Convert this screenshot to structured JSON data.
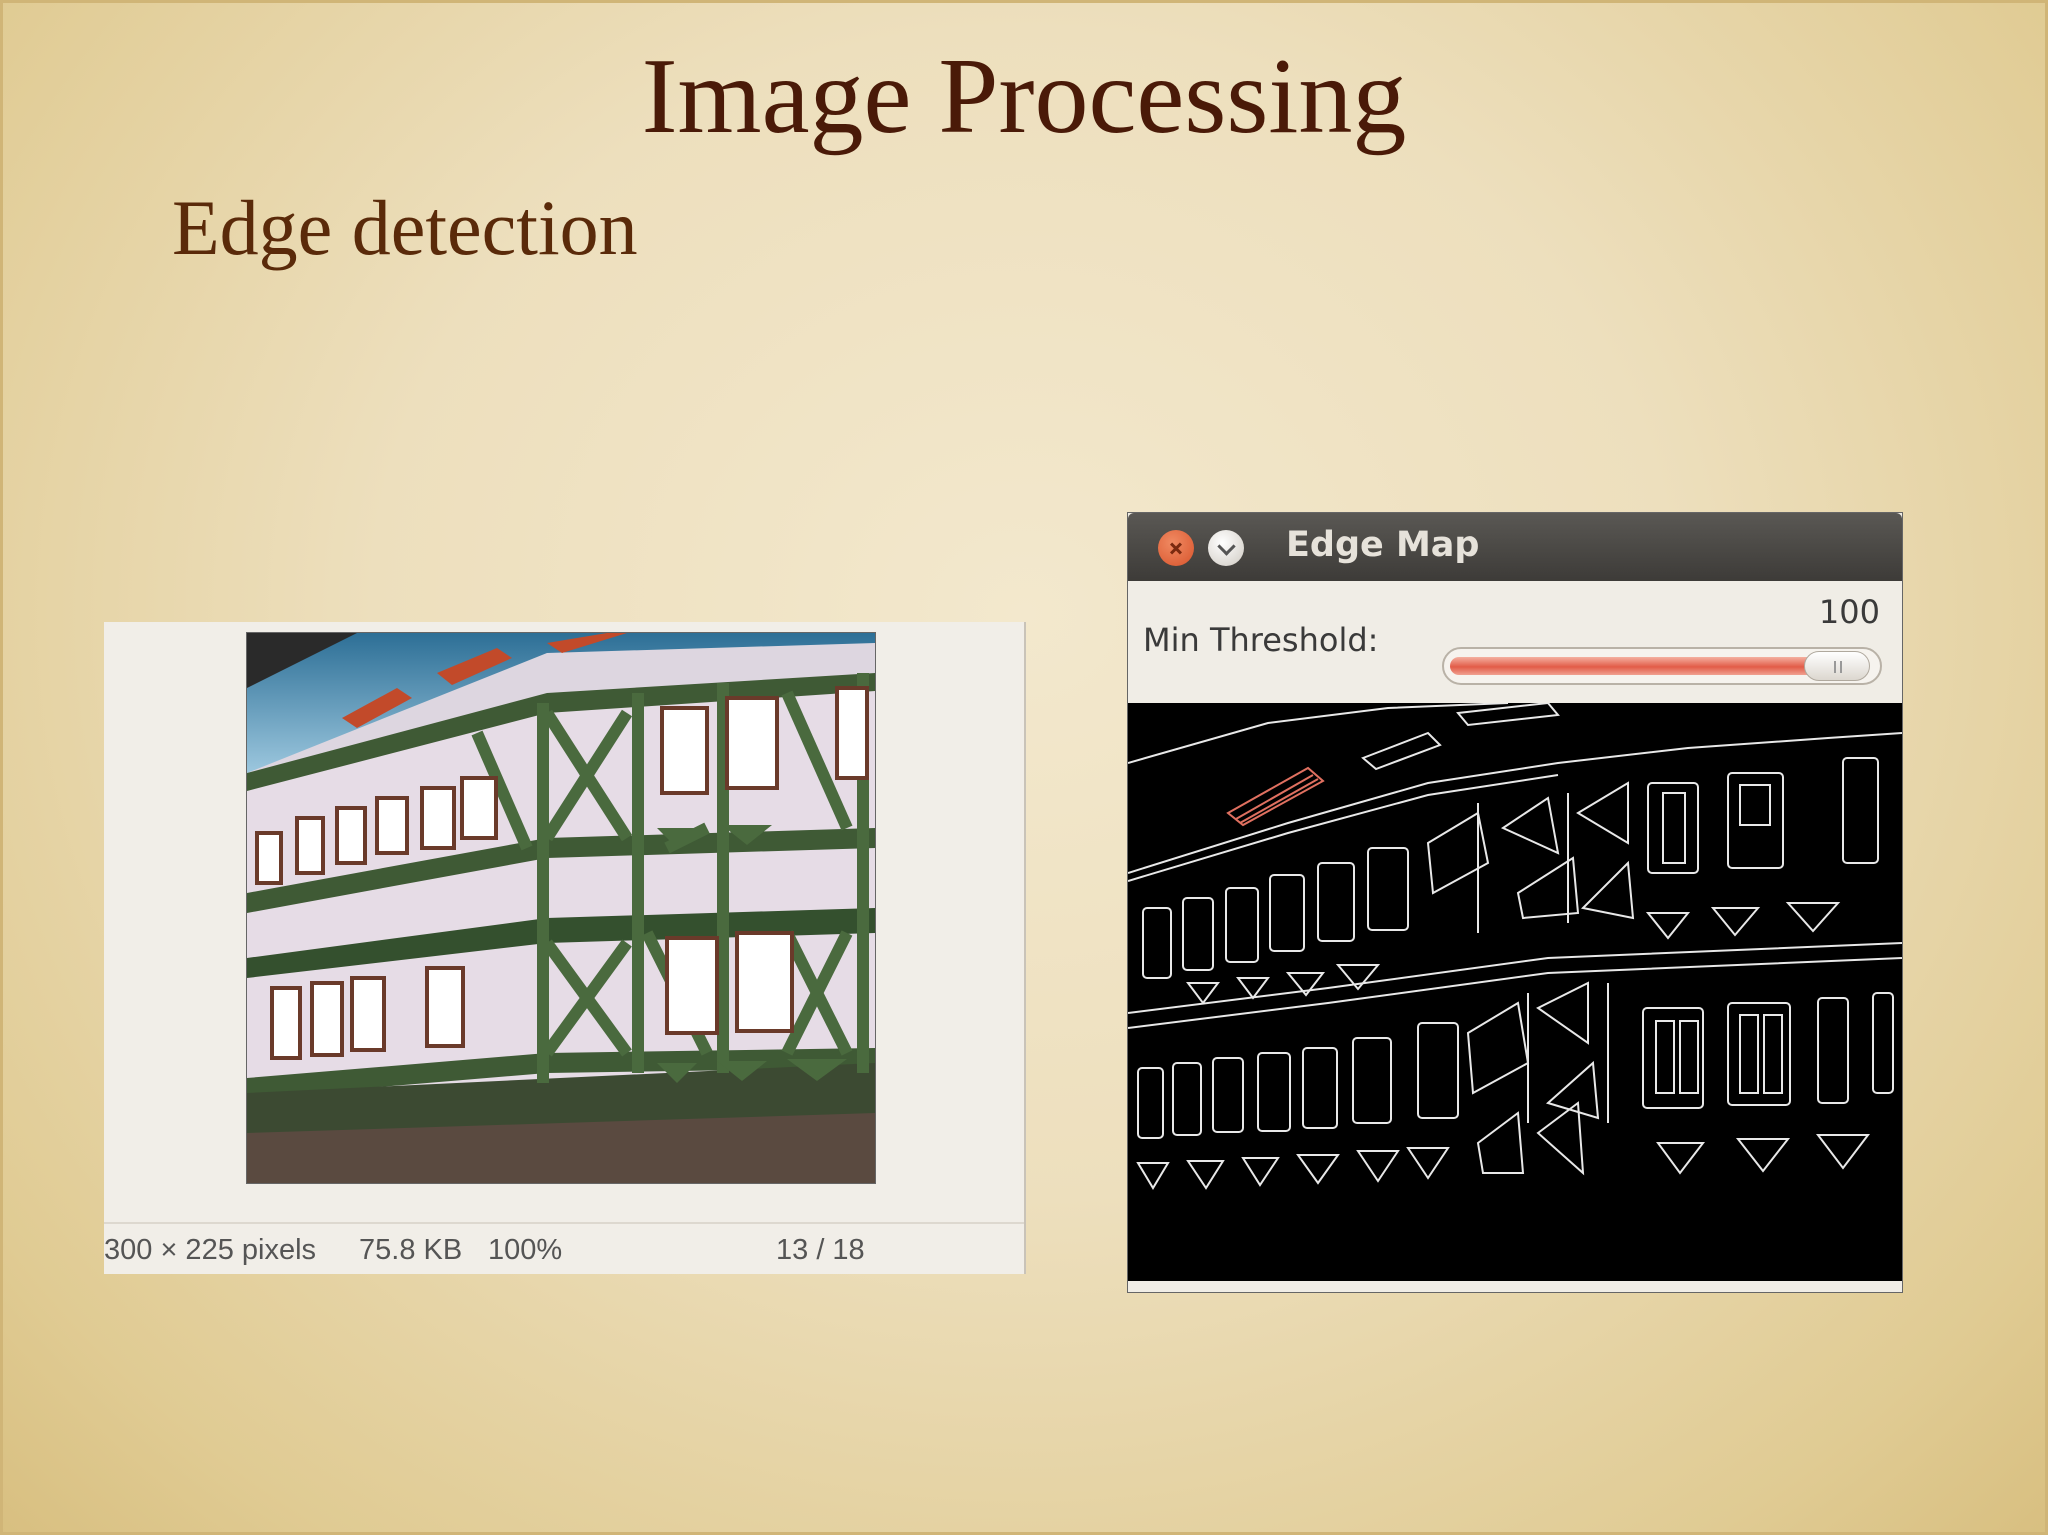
{
  "slide": {
    "title": "Image Processing",
    "subtitle": "Edge detection"
  },
  "viewer": {
    "status": {
      "dimensions": "300 × 225 pixels",
      "file_size": "75.8 KB",
      "zoom": "100%",
      "position": "13 / 18"
    }
  },
  "edge_window": {
    "title": "Edge Map",
    "threshold_label": "Min Threshold:",
    "threshold_value": "100",
    "threshold_fraction": 0.99,
    "slider_color": "#e25c48"
  }
}
